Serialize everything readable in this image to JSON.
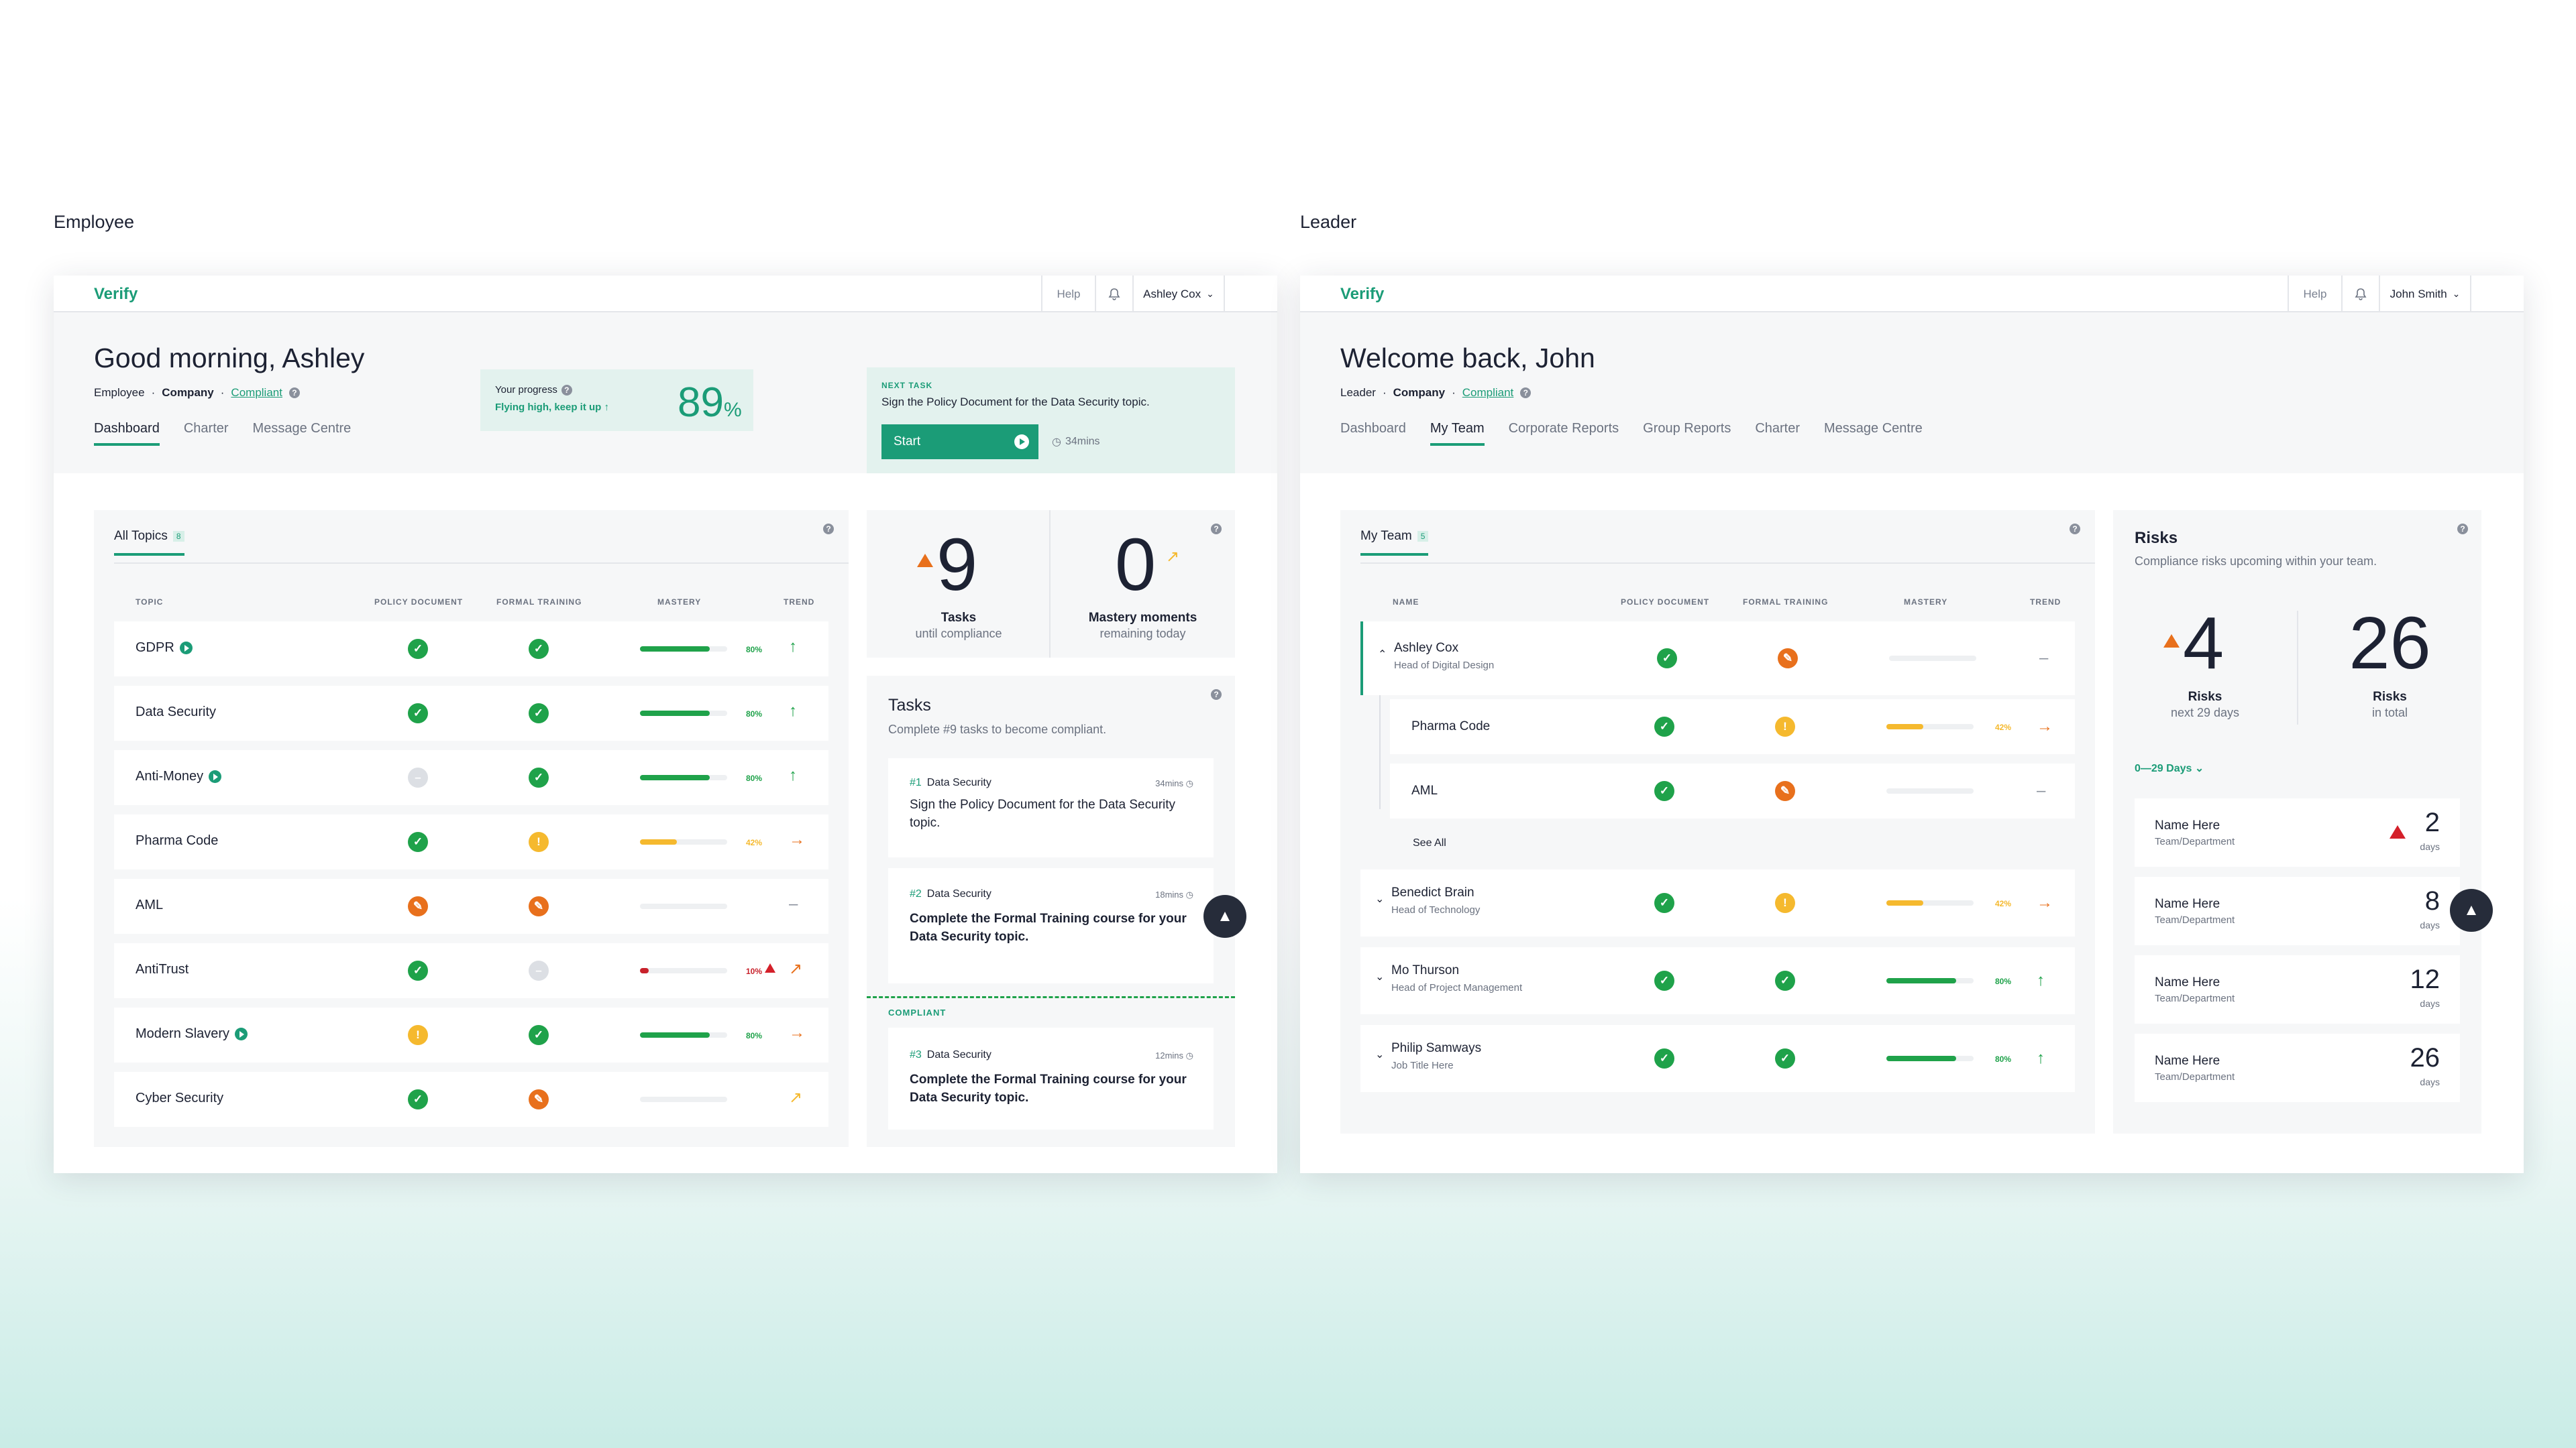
{
  "captions": {
    "employee": "Employee",
    "leader": "Leader"
  },
  "colors": {
    "accent": "#1b9c77",
    "green": "#1fa24a",
    "orange": "#e8701c",
    "yellow": "#f5b92e",
    "red": "#c8212b"
  },
  "employee": {
    "topbar": {
      "logo": "Verify",
      "help": "Help",
      "user": "Ashley Cox"
    },
    "header": {
      "greeting": "Good morning, Ashley",
      "role": "Employee",
      "company": "Company",
      "status": "Compliant",
      "progress_label": "Your progress",
      "progress_msg": "Flying high, keep it up ↑",
      "progress_value": "89",
      "progress_unit": "%",
      "next_task_label": "NEXT TASK",
      "next_task_text": "Sign the Policy Document for the Data Security topic.",
      "start_label": "Start",
      "time": "34mins"
    },
    "tabs": [
      "Dashboard",
      "Charter",
      "Message Centre"
    ],
    "topics": {
      "title": "All Topics",
      "count": "8",
      "columns": [
        "TOPIC",
        "POLICY DOCUMENT",
        "FORMAL TRAINING",
        "MASTERY",
        "TREND"
      ],
      "rows": [
        {
          "name": "GDPR",
          "pct": "80%",
          "mastery": 0.8
        },
        {
          "name": "Data Security",
          "pct": "80%",
          "mastery": 0.8
        },
        {
          "name": "Anti-Money",
          "pct": "80%",
          "mastery": 0.8
        },
        {
          "name": "Pharma Code",
          "pct": "42%",
          "mastery": 0.42
        },
        {
          "name": "AML",
          "pct": "",
          "mastery": 0
        },
        {
          "name": "AntiTrust",
          "pct": "10%",
          "mastery": 0.1
        },
        {
          "name": "Modern Slavery",
          "pct": "80%",
          "mastery": 0.8
        },
        {
          "name": "Cyber Security",
          "pct": "",
          "mastery": 0
        }
      ]
    },
    "stats": {
      "tasks_value": "9",
      "tasks_label": "Tasks",
      "tasks_sub": "until compliance",
      "mastery_value": "0",
      "mastery_label": "Mastery moments",
      "mastery_sub": "remaining today"
    },
    "tasks": {
      "title": "Tasks",
      "subtitle": "Complete #9 tasks to become compliant.",
      "compliant_label": "COMPLIANT",
      "items": [
        {
          "num": "#1",
          "topic": "Data Security",
          "time": "34mins",
          "text": "Sign the Policy Document for the Data Security topic."
        },
        {
          "num": "#2",
          "topic": "Data Security",
          "time": "18mins",
          "text": "Complete the Formal Training course for your Data Security topic."
        },
        {
          "num": "#3",
          "topic": "Data Security",
          "time": "12mins",
          "text": "Complete the Formal Training course for your Data Security topic."
        }
      ]
    }
  },
  "leader": {
    "topbar": {
      "logo": "Verify",
      "help": "Help",
      "user": "John Smith"
    },
    "header": {
      "greeting": "Welcome back, John",
      "role": "Leader",
      "company": "Company",
      "status": "Compliant"
    },
    "tabs": [
      "Dashboard",
      "My Team",
      "Corporate Reports",
      "Group Reports",
      "Charter",
      "Message Centre"
    ],
    "team": {
      "title": "My Team",
      "count": "5",
      "columns": [
        "NAME",
        "POLICY DOCUMENT",
        "FORMAL TRAINING",
        "MASTERY",
        "TREND"
      ],
      "rows": [
        {
          "name": "Ashley Cox",
          "job": "Head of Digital Design",
          "pct": "",
          "mastery": 0
        },
        {
          "name": "Pharma Code",
          "job": "",
          "pct": "42%",
          "mastery": 0.42
        },
        {
          "name": "AML",
          "job": "",
          "pct": "",
          "mastery": 0
        },
        {
          "name": "Benedict Brain",
          "job": "Head of Technology",
          "pct": "42%",
          "mastery": 0.42
        },
        {
          "name": "Mo Thurson",
          "job": "Head of Project Management",
          "pct": "80%",
          "mastery": 0.8
        },
        {
          "name": "Philip Samways",
          "job": "Job Title Here",
          "pct": "80%",
          "mastery": 0.8
        }
      ],
      "see_all": "See All"
    },
    "risks": {
      "title": "Risks",
      "subtitle": "Compliance risks upcoming within your team.",
      "upcoming_value": "4",
      "upcoming_label": "Risks",
      "upcoming_sub": "next 29 days",
      "total_value": "26",
      "total_label": "Risks",
      "total_sub": "in total",
      "filter": "0—29 Days",
      "items": [
        {
          "name": "Name Here",
          "team": "Team/Department",
          "days": "2",
          "unit": "days"
        },
        {
          "name": "Name Here",
          "team": "Team/Department",
          "days": "8",
          "unit": "days"
        },
        {
          "name": "Name Here",
          "team": "Team/Department",
          "days": "12",
          "unit": "days"
        },
        {
          "name": "Name Here",
          "team": "Team/Department",
          "days": "26",
          "unit": "days"
        }
      ]
    }
  }
}
